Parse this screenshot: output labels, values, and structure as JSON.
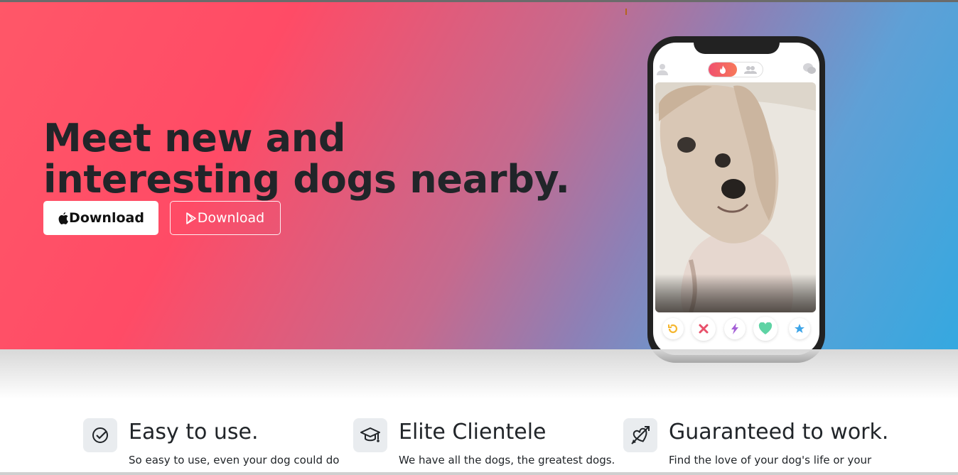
{
  "hero": {
    "headline": "Meet new and interesting dogs nearby.",
    "app_store_button": "Download",
    "play_store_button": "Download"
  },
  "phone": {
    "icons": {
      "profile": "profile-icon",
      "chat": "chat-icon",
      "toggle_active": "flame-icon",
      "toggle_inactive": "group-icon"
    },
    "actions": [
      "rewind-icon",
      "nope-icon",
      "boost-icon",
      "like-icon",
      "super-like-icon"
    ]
  },
  "features": [
    {
      "icon": "check-circle-icon",
      "title": "Easy to use.",
      "text": "So easy to use, even your dog could do"
    },
    {
      "icon": "graduation-cap-icon",
      "title": "Elite Clientele",
      "text": "We have all the dogs, the greatest dogs."
    },
    {
      "icon": "heart-arrow-icon",
      "title": "Guaranteed to work.",
      "text": "Find the love of your dog's life or your"
    }
  ],
  "colors": {
    "gradient_start": "#ff5768",
    "gradient_mid": "#c56a8e",
    "gradient_end": "#35a8e0",
    "headline": "#212529"
  }
}
